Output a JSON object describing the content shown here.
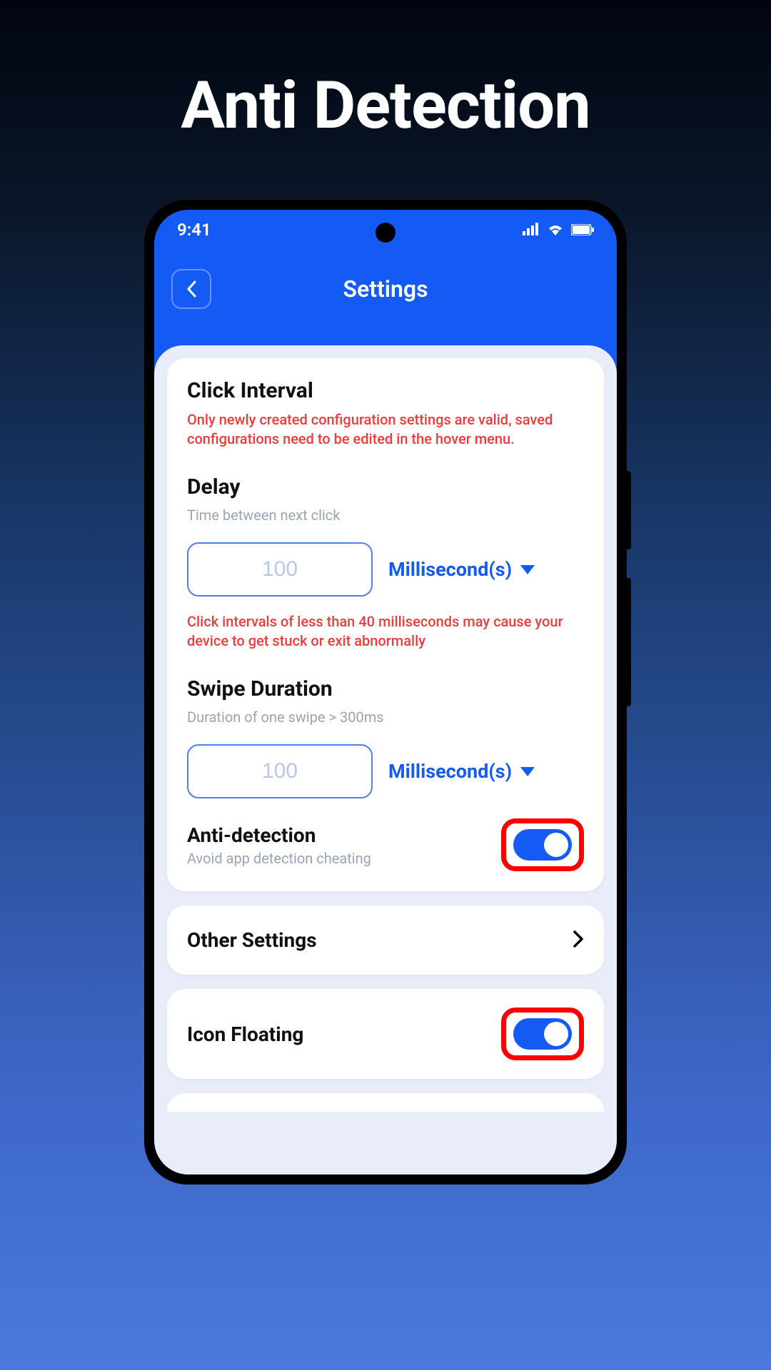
{
  "promo_title": "Anti Detection",
  "statusbar": {
    "time": "9:41"
  },
  "header": {
    "title": "Settings"
  },
  "colors": {
    "primary": "#145bf5",
    "warning": "#ef3b3b",
    "highlight": "#ff0000"
  },
  "click_interval": {
    "title": "Click Interval",
    "warning": "Only newly created configuration settings are valid, saved configurations need to be edited in the hover menu."
  },
  "delay": {
    "title": "Delay",
    "subtitle": "Time between next click",
    "value": "100",
    "unit_label": "Millisecond(s)",
    "warning": "Click intervals of less than 40 milliseconds may cause your device to get stuck or exit abnormally"
  },
  "swipe": {
    "title": "Swipe Duration",
    "subtitle": "Duration of one swipe > 300ms",
    "value": "100",
    "unit_label": "Millisecond(s)"
  },
  "anti_detection": {
    "title": "Anti-detection",
    "subtitle": "Avoid app detection cheating",
    "enabled": true
  },
  "other_settings": {
    "title": "Other Settings"
  },
  "icon_floating": {
    "title": "Icon Floating",
    "enabled": true
  }
}
